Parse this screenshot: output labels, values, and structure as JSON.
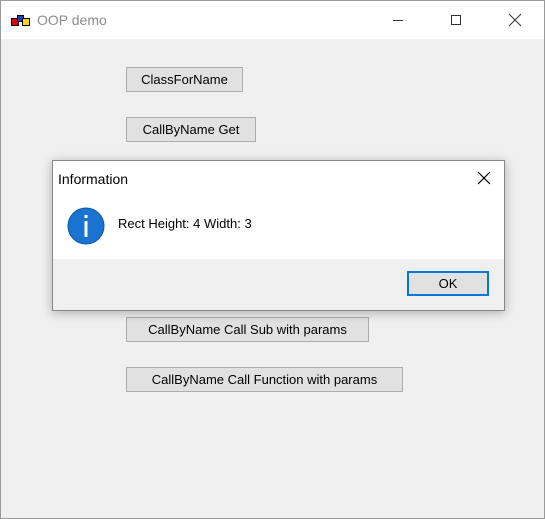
{
  "window": {
    "title": "OOP demo",
    "app_icon": "app-shapes-icon",
    "controls": {
      "minimize_icon": "minimize-icon",
      "maximize_icon": "maximize-icon",
      "close_icon": "close-icon"
    }
  },
  "form": {
    "buttons": [
      {
        "label": "ClassForName"
      },
      {
        "label": "CallByName Get"
      },
      {
        "label": "CallByName Call Sub with params"
      },
      {
        "label": "CallByName Call Function with params"
      }
    ]
  },
  "dialog": {
    "title": "Information",
    "message": "Rect Height: 4 Width: 3",
    "icon": "information-icon",
    "ok_label": "OK"
  },
  "colors": {
    "accent": "#0078d7",
    "button_face": "#e1e1e1",
    "window_bg": "#f0f0f0"
  }
}
